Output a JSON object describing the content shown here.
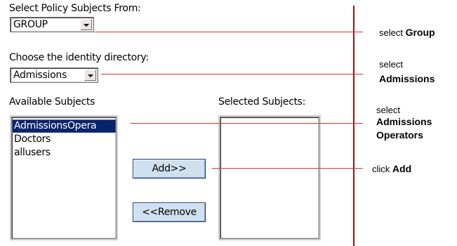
{
  "form": {
    "subjects_from_label": "Select Policy Subjects From:",
    "subjects_from_value": "GROUP",
    "identity_dir_label": "Choose the identity directory:",
    "identity_dir_value": "Admissions",
    "available_label": "Available Subjects",
    "selected_label": "Selected Subjects:",
    "available_items": [
      "AdmissionsOpera",
      "Doctors",
      "allusers"
    ],
    "available_selected_index": 0,
    "selected_items": [],
    "add_button": "Add>>",
    "remove_button": "<<Remove"
  },
  "annotations": {
    "a1_prefix": "select",
    "a1_bold": "Group",
    "a2_prefix": "select",
    "a2_bold": "Admissions",
    "a3_prefix": "select",
    "a3_bold_line1": "Admissions",
    "a3_bold_line2": "Operators",
    "a4_prefix": "click",
    "a4_bold": "Add"
  },
  "colors": {
    "callout_line": "#e03030",
    "divider": "#a01010",
    "selection": "#0a246a",
    "button_face": "#cfe0ef"
  }
}
